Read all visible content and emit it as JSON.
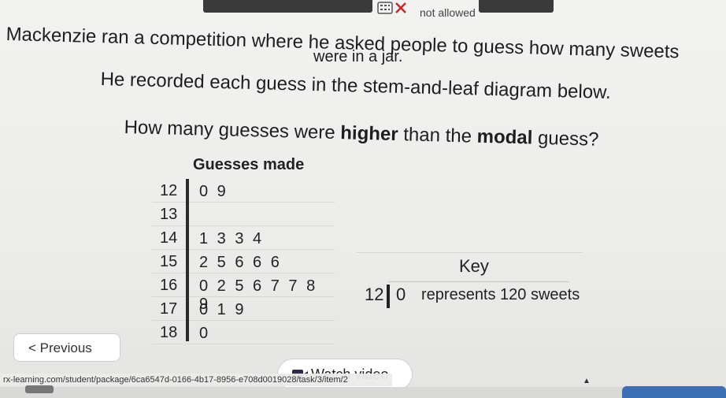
{
  "calculator": {
    "icon": "calculator-crossed-icon",
    "status_label": "not allowed"
  },
  "question": {
    "line1": "Mackenzie ran a competition where he asked people to guess how many sweets",
    "line2": "were in a jar.",
    "line3": "He recorded each guess in the stem-and-leaf diagram below.",
    "line4_prefix": "How many guesses were ",
    "line4_bold1": "higher",
    "line4_mid": " than the ",
    "line4_bold2": "modal",
    "line4_suffix": " guess?"
  },
  "chart_data": {
    "type": "table",
    "title": "Guesses made",
    "rows": [
      {
        "stem": "12",
        "leaves": "0 9"
      },
      {
        "stem": "13",
        "leaves": ""
      },
      {
        "stem": "14",
        "leaves": "1 3 3 4"
      },
      {
        "stem": "15",
        "leaves": "2 5 6 6 6"
      },
      {
        "stem": "16",
        "leaves": "0 2 5 6 7 7 8 9"
      },
      {
        "stem": "17",
        "leaves": "0 1 9"
      },
      {
        "stem": "18",
        "leaves": "0"
      }
    ],
    "key": {
      "title": "Key",
      "stem": "12",
      "leaf": "0",
      "text": "represents 120 sweets"
    }
  },
  "nav": {
    "previous_label": "< Previous",
    "watch_video_label": "Watch video",
    "watch_icon": "video-icon"
  },
  "url": "rx-learning.com/student/package/6ca6547d-0166-4b17-8956-e708d0019028/task/3/item/2"
}
